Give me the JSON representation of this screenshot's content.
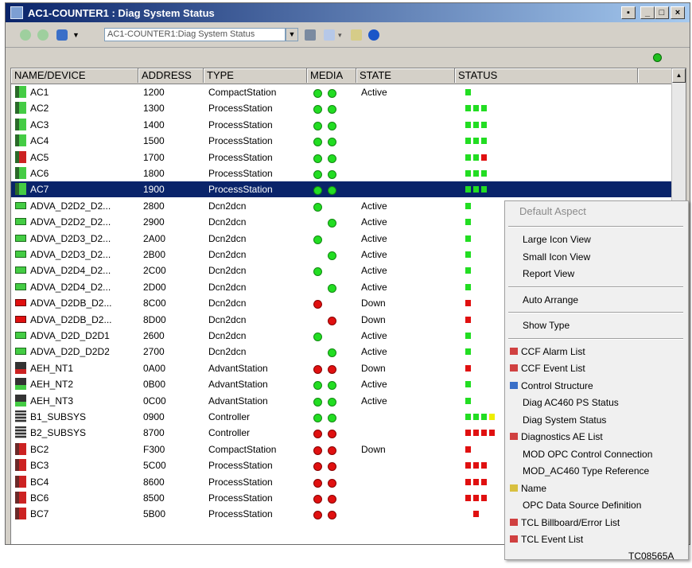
{
  "window": {
    "title": "AC1-COUNTER1 : Diag System Status",
    "controls": {
      "restore": "▪",
      "minimize": "_",
      "maximize": "□",
      "close": "×"
    }
  },
  "toolbar": {
    "address": "AC1-COUNTER1:Diag System Status",
    "icons": [
      "back-arrow-icon",
      "forward-arrow-icon",
      "object-cube-icon",
      "dropdown-arrow-icon",
      "print-icon",
      "view-icon",
      "pin-icon",
      "help-icon"
    ]
  },
  "columns": [
    "NAME/DEVICE",
    "ADDRESS",
    "TYPE",
    "MEDIA",
    "STATE",
    "STATUS"
  ],
  "colors": {
    "green": "#22dd22",
    "red": "#e01010",
    "yellow": "#eeee00",
    "selection": "#0a246a"
  },
  "rows": [
    {
      "name": "AC1",
      "address": "1200",
      "type": "CompactStation",
      "media": [
        "g",
        "g"
      ],
      "state": "Active",
      "status": "g",
      "icon": "station"
    },
    {
      "name": "AC2",
      "address": "1300",
      "type": "ProcessStation",
      "media": [
        "g",
        "g"
      ],
      "state": "",
      "status": "ggg",
      "icon": "station"
    },
    {
      "name": "AC3",
      "address": "1400",
      "type": "ProcessStation",
      "media": [
        "g",
        "g"
      ],
      "state": "",
      "status": "ggg",
      "icon": "station"
    },
    {
      "name": "AC4",
      "address": "1500",
      "type": "ProcessStation",
      "media": [
        "g",
        "g"
      ],
      "state": "",
      "status": "ggg",
      "icon": "station"
    },
    {
      "name": "AC5",
      "address": "1700",
      "type": "ProcessStation",
      "media": [
        "g",
        "g"
      ],
      "state": "",
      "status": "ggr",
      "icon": "station-alarm"
    },
    {
      "name": "AC6",
      "address": "1800",
      "type": "ProcessStation",
      "media": [
        "g",
        "g"
      ],
      "state": "",
      "status": "ggg",
      "icon": "station"
    },
    {
      "name": "AC7",
      "address": "1900",
      "type": "ProcessStation",
      "media": [
        "g",
        "g"
      ],
      "state": "",
      "status": "ggg",
      "icon": "station",
      "selected": true
    },
    {
      "name": "ADVA_D2D2_D2...",
      "address": "2800",
      "type": "Dcn2dcn",
      "media": [
        "g",
        ""
      ],
      "state": "Active",
      "status": "g",
      "icon": "dcn-ok"
    },
    {
      "name": "ADVA_D2D2_D2...",
      "address": "2900",
      "type": "Dcn2dcn",
      "media": [
        "",
        "g"
      ],
      "state": "Active",
      "status": "g",
      "icon": "dcn-ok"
    },
    {
      "name": "ADVA_D2D3_D2...",
      "address": "2A00",
      "type": "Dcn2dcn",
      "media": [
        "g",
        ""
      ],
      "state": "Active",
      "status": "g",
      "icon": "dcn-ok"
    },
    {
      "name": "ADVA_D2D3_D2...",
      "address": "2B00",
      "type": "Dcn2dcn",
      "media": [
        "",
        "g"
      ],
      "state": "Active",
      "status": "g",
      "icon": "dcn-ok"
    },
    {
      "name": "ADVA_D2D4_D2...",
      "address": "2C00",
      "type": "Dcn2dcn",
      "media": [
        "g",
        ""
      ],
      "state": "Active",
      "status": "g",
      "icon": "dcn-ok"
    },
    {
      "name": "ADVA_D2D4_D2...",
      "address": "2D00",
      "type": "Dcn2dcn",
      "media": [
        "",
        "g"
      ],
      "state": "Active",
      "status": "g",
      "icon": "dcn-ok"
    },
    {
      "name": "ADVA_D2DB_D2...",
      "address": "8C00",
      "type": "Dcn2dcn",
      "media": [
        "r",
        ""
      ],
      "state": "Down",
      "status": "r",
      "icon": "dcn-down"
    },
    {
      "name": "ADVA_D2DB_D2...",
      "address": "8D00",
      "type": "Dcn2dcn",
      "media": [
        "",
        "r"
      ],
      "state": "Down",
      "status": "r",
      "icon": "dcn-down"
    },
    {
      "name": "ADVA_D2D_D2D1",
      "address": "2600",
      "type": "Dcn2dcn",
      "media": [
        "g",
        ""
      ],
      "state": "Active",
      "status": "g",
      "icon": "dcn-ok"
    },
    {
      "name": "ADVA_D2D_D2D2",
      "address": "2700",
      "type": "Dcn2dcn",
      "media": [
        "",
        "g"
      ],
      "state": "Active",
      "status": "g",
      "icon": "dcn-ok"
    },
    {
      "name": "AEH_NT1",
      "address": "0A00",
      "type": "AdvantStation",
      "media": [
        "r",
        "r"
      ],
      "state": "Down",
      "status": "r",
      "icon": "pc-down"
    },
    {
      "name": "AEH_NT2",
      "address": "0B00",
      "type": "AdvantStation",
      "media": [
        "g",
        "g"
      ],
      "state": "Active",
      "status": "g",
      "icon": "pc-ok"
    },
    {
      "name": "AEH_NT3",
      "address": "0C00",
      "type": "AdvantStation",
      "media": [
        "g",
        "g"
      ],
      "state": "Active",
      "status": "g",
      "icon": "pc-ok"
    },
    {
      "name": "B1_SUBSYS",
      "address": "0900",
      "type": "Controller",
      "media": [
        "g",
        "g"
      ],
      "state": "",
      "status": "gggy",
      "icon": "controller"
    },
    {
      "name": "B2_SUBSYS",
      "address": "8700",
      "type": "Controller",
      "media": [
        "r",
        "r"
      ],
      "state": "",
      "status": "rrrr",
      "icon": "controller"
    },
    {
      "name": "BC2",
      "address": "F300",
      "type": "CompactStation",
      "media": [
        "r",
        "r"
      ],
      "state": "Down",
      "status": "r",
      "icon": "station-down"
    },
    {
      "name": "BC3",
      "address": "5C00",
      "type": "ProcessStation",
      "media": [
        "r",
        "r"
      ],
      "state": "",
      "status": "rrr",
      "icon": "station-down"
    },
    {
      "name": "BC4",
      "address": "8600",
      "type": "ProcessStation",
      "media": [
        "r",
        "r"
      ],
      "state": "",
      "status": "rrr",
      "icon": "station-down"
    },
    {
      "name": "BC6",
      "address": "8500",
      "type": "ProcessStation",
      "media": [
        "r",
        "r"
      ],
      "state": "",
      "status": "rrr",
      "icon": "station-down"
    },
    {
      "name": "BC7",
      "address": "5B00",
      "type": "ProcessStation",
      "media": [
        "r",
        "r"
      ],
      "state": "",
      "status": " r",
      "icon": "station-down"
    }
  ],
  "context_menu": [
    {
      "label": "Default Aspect",
      "disabled": true
    },
    {
      "sep": true
    },
    {
      "label": "Large Icon View"
    },
    {
      "label": "Small Icon View"
    },
    {
      "label": "Report View"
    },
    {
      "sep": true
    },
    {
      "label": "Auto Arrange"
    },
    {
      "sep": true
    },
    {
      "label": "Show Type"
    },
    {
      "sep": true
    },
    {
      "label": "CCF Alarm List",
      "icon": "alarm-list-icon"
    },
    {
      "label": "CCF Event List",
      "icon": "event-list-icon"
    },
    {
      "label": "Control Structure",
      "icon": "structure-icon"
    },
    {
      "label": "Diag AC460 PS Status"
    },
    {
      "label": "Diag System Status"
    },
    {
      "label": "Diagnostics AE List",
      "icon": "alarm-list-icon"
    },
    {
      "label": "MOD OPC Control Connection"
    },
    {
      "label": "MOD_AC460 Type Reference"
    },
    {
      "label": "Name",
      "icon": "name-icon"
    },
    {
      "label": "OPC Data Source Definition"
    },
    {
      "label": "TCL Billboard/Error List",
      "icon": "alarm-list-icon"
    },
    {
      "label": "TCL Event List",
      "icon": "event-list-icon"
    }
  ],
  "footer": "TC08565A"
}
